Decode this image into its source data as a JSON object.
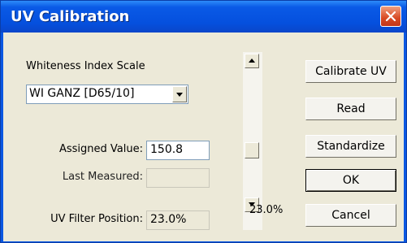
{
  "dialog": {
    "title": "UV Calibration",
    "close_icon": "close-icon"
  },
  "form": {
    "whiteness_label": "Whiteness Index Scale",
    "whiteness_value": "WI GANZ [D65/10]",
    "assigned_label": "Assigned Value:",
    "assigned_value": "150.8",
    "last_measured_label": "Last Measured:",
    "last_measured_value": "",
    "filter_label": "UV Filter Position:",
    "filter_value": "23.0%"
  },
  "slider": {
    "value_label": "23.0%",
    "position_fraction": 0.23
  },
  "buttons": {
    "calibrate": "Calibrate UV",
    "read": "Read",
    "standardize": "Standardize",
    "ok": "OK",
    "cancel": "Cancel"
  },
  "colors": {
    "titlebar": "#0550de",
    "face": "#ece9d8",
    "close": "#d84a23"
  }
}
